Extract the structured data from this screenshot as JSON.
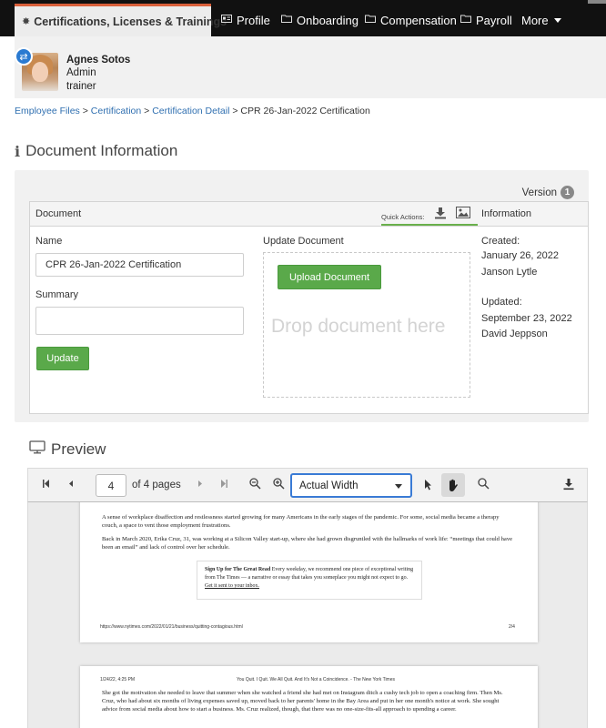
{
  "nav": {
    "active_tab": "Certifications, Licenses & Trainings",
    "items": [
      "Profile",
      "Onboarding",
      "Compensation",
      "Payroll",
      "More"
    ]
  },
  "employee": {
    "name": "Agnes Sotos",
    "role1": "Admin",
    "role2": "trainer"
  },
  "breadcrumb": {
    "links": [
      "Employee Files",
      "Certification",
      "Certification Detail"
    ],
    "separator": ">",
    "current": "CPR 26-Jan-2022 Certification"
  },
  "document_section": {
    "title": "Document Information",
    "version_label": "Version",
    "version_number": "1",
    "header_document": "Document",
    "quick_actions": "Quick Actions:",
    "header_information": "Information",
    "name_label": "Name",
    "name_value": "CPR 26-Jan-2022 Certification",
    "summary_label": "Summary",
    "summary_value": "",
    "update_button": "Update",
    "update_document_label": "Update Document",
    "upload_button": "Upload Document",
    "drop_text": "Drop document here",
    "created_label": "Created:",
    "created_date": "January 26, 2022",
    "created_by": "Janson Lytle",
    "updated_label": "Updated:",
    "updated_date": "September 23, 2022",
    "updated_by": "David Jeppson"
  },
  "preview": {
    "title": "Preview",
    "page_number": "4",
    "of_pages": "of 4 pages",
    "zoom": "Actual Width"
  },
  "pdf_page_a": {
    "para1": "A sense of workplace disaffection and restlessness started growing for many Americans in the early stages of the pandemic. For some, social media became a therapy couch, a space to vent those employment frustrations.",
    "para2": "Back in March 2020, Erika Cruz, 31, was working at a Silicon Valley start-up, where she had grown disgruntled with the hallmarks of work life: “meetings that could have been an email” and lack of control over her schedule.",
    "signup_title": "Sign Up for The Great Read",
    "signup_body": "Every weekday, we recommend one piece of exceptional writing from The Times — a narrative or essay that takes you someplace you might not expect to go.",
    "signup_link": "Get it sent to your inbox.",
    "footer_url": "https://www.nytimes.com/2022/01/21/business/quitting-contagious.html",
    "footer_page": "2/4"
  },
  "pdf_page_b": {
    "header_date": "1/24/22, 4:25 PM",
    "header_title": "You Quit. I Quit. We All Quit. And It's Not a Coincidence. - The New York Times",
    "para1": "She got the motivation she needed to leave that summer when she watched a friend she had met on Instagram ditch a cushy tech job to open a coaching firm. Then Ms. Cruz, who had about six months of living expenses saved up, moved back to her parents' home in the Bay Area and put in her one month's notice at work. She sought advice from social media about how to start a business. Ms. Cruz realized, though, that there was no one-size-fits-all approach to upending a career."
  }
}
